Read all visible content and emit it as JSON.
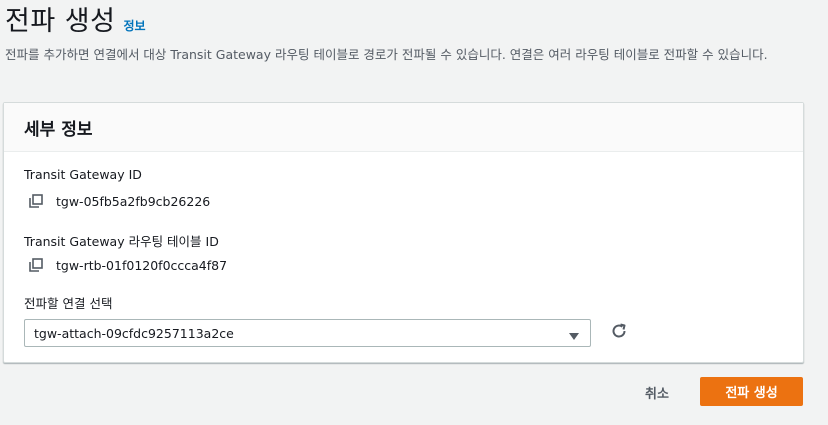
{
  "header": {
    "title": "전파 생성",
    "info_link": "정보",
    "description": "전파를 추가하면 연결에서 대상 Transit Gateway 라우팅 테이블로 경로가 전파될 수 있습니다. 연결은 여러 라우팅 테이블로 전파할 수 있습니다."
  },
  "details": {
    "title": "세부 정보",
    "tgw_id_label": "Transit Gateway ID",
    "tgw_id_value": "tgw-05fb5a2fb9cb26226",
    "route_table_label": "Transit Gateway 라우팅 테이블 ID",
    "route_table_value": "tgw-rtb-01f0120f0ccca4f87",
    "attachment_label": "전파할 연결 선택",
    "attachment_selected": "tgw-attach-09cfdc9257113a2ce"
  },
  "icons": {
    "copy": "copy-icon",
    "caret": "caret-down-icon",
    "refresh": "refresh-icon"
  },
  "actions": {
    "cancel_label": "취소",
    "create_label": "전파 생성"
  },
  "colors": {
    "accent": "#ec7211",
    "link": "#0073bb",
    "background": "#f2f3f3"
  }
}
